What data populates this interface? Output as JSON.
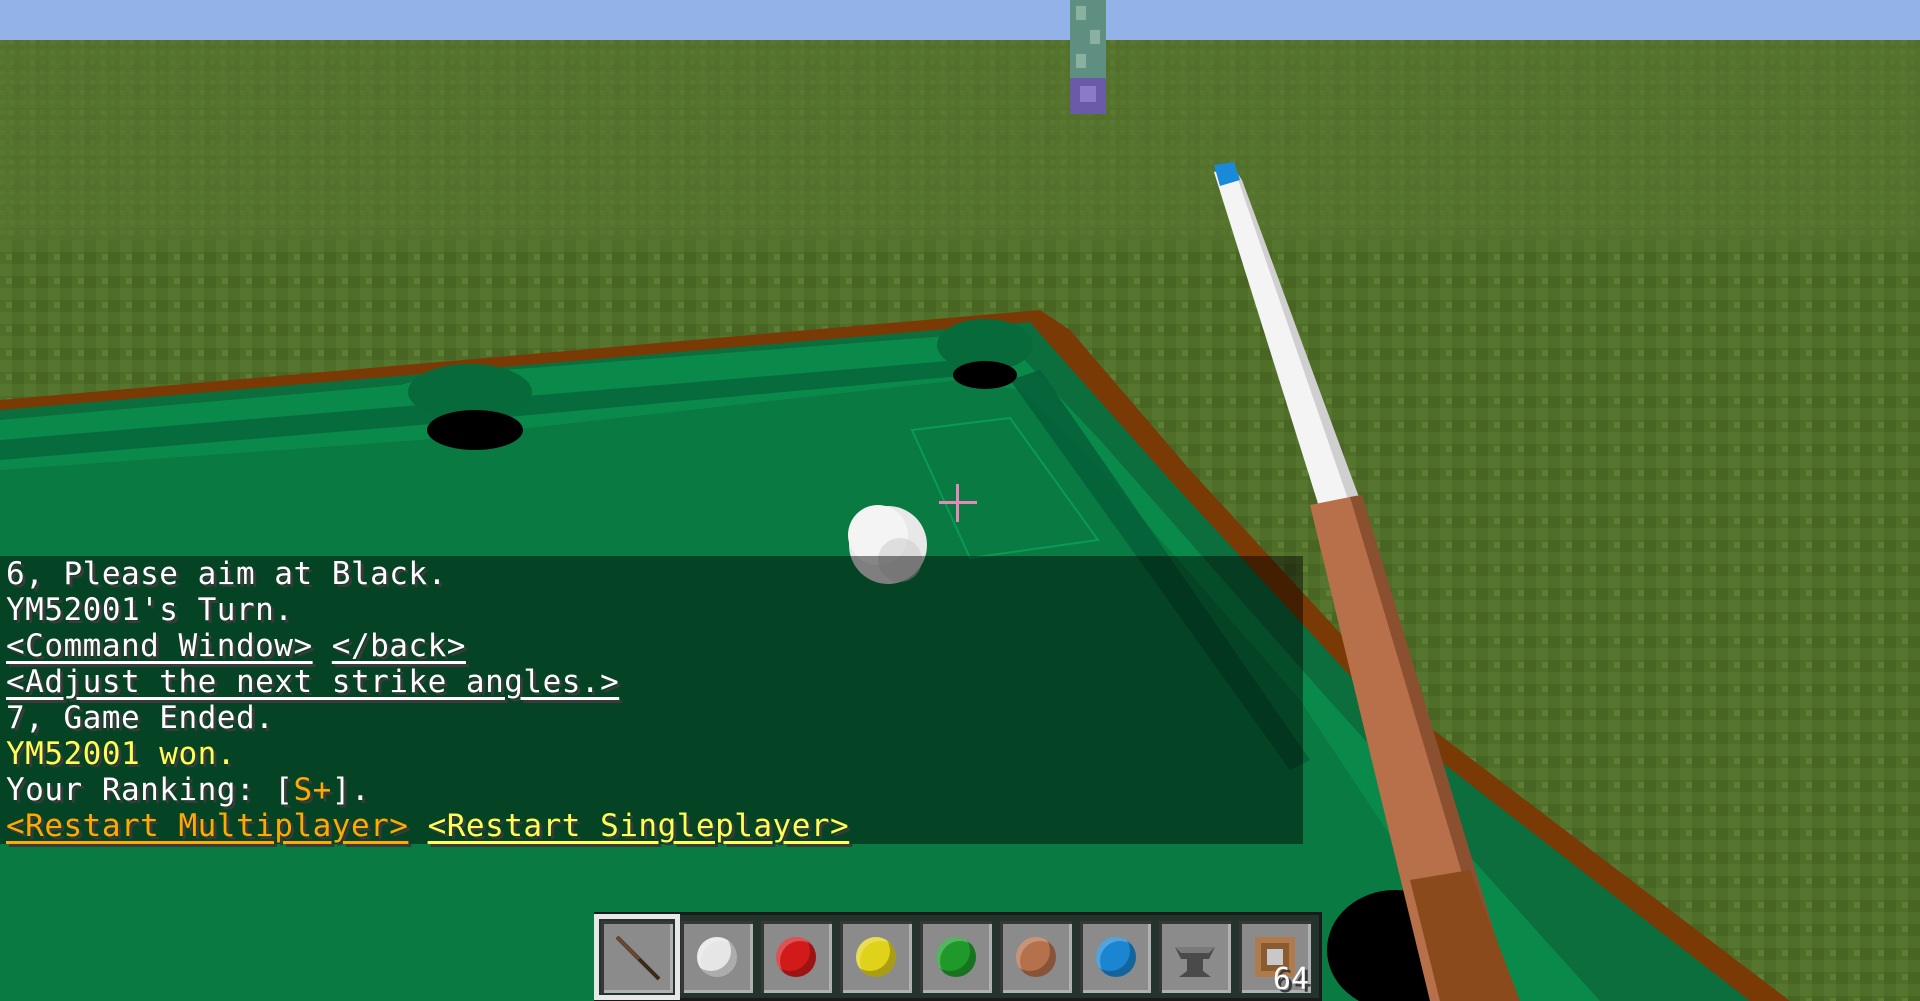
{
  "chat": {
    "line1": "6, Please aim at Black.",
    "line2": "YM52001's Turn.",
    "line3_link1": "<Command Window>",
    "line3_link2": "</back>",
    "line4_link": "<Adjust the next strike angles.>",
    "line5": "7, Game Ended.",
    "line6": "YM52001 won.",
    "line7_prefix": "Your Ranking: [",
    "line7_rank": "S+",
    "line7_suffix": "].",
    "line8_link1": "<Restart Multiplayer>",
    "line8_link2": "<Restart Singleplayer>"
  },
  "colors": {
    "sky": "#8fb0e6",
    "grass": "#4f6e28",
    "felt": "#087a42",
    "rail_wood": "#7a3a05",
    "chat_yellow": "#ffff55",
    "chat_gold": "#ffaa00"
  },
  "hotbar": {
    "selected_slot": 0,
    "slots": [
      {
        "icon": "cue-stick-icon",
        "color": "#5a3a20"
      },
      {
        "icon": "white-ball-icon",
        "color": "#e6e6e6"
      },
      {
        "icon": "red-ball-icon",
        "color": "#d11a1a"
      },
      {
        "icon": "yellow-ball-icon",
        "color": "#e0d21a"
      },
      {
        "icon": "green-ball-icon",
        "color": "#1f9a2a"
      },
      {
        "icon": "brown-ball-icon",
        "color": "#b5704c"
      },
      {
        "icon": "blue-ball-icon",
        "color": "#1a86d1"
      },
      {
        "icon": "anvil-icon",
        "color": "#555555"
      },
      {
        "icon": "command-block-icon",
        "color": "#b07a4a",
        "count": "64"
      }
    ]
  }
}
